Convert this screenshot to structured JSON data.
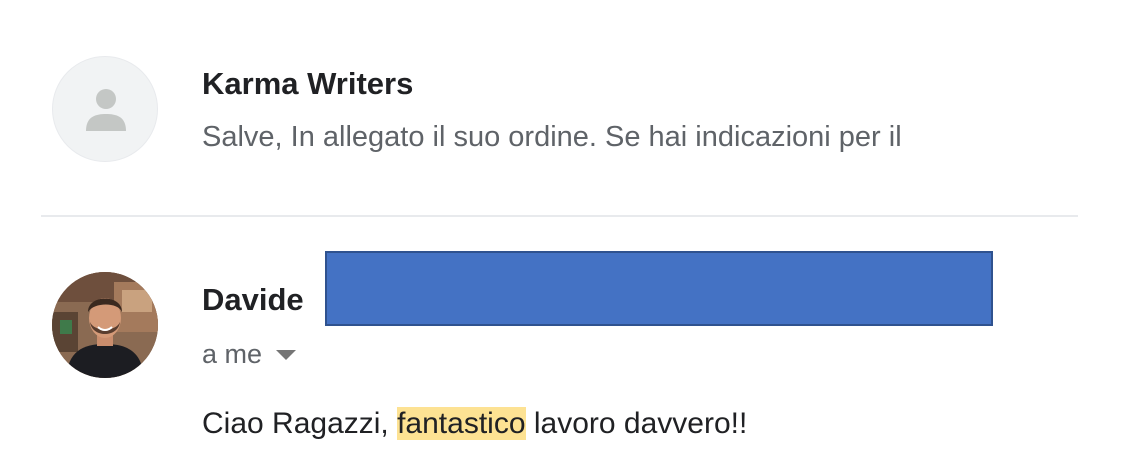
{
  "messages": [
    {
      "sender": "Karma Writers",
      "snippet": "Salve, In allegato il suo ordine. Se hai indicazioni per il",
      "avatar": "person-placeholder-icon"
    },
    {
      "sender": "Davide",
      "recipient": "a me",
      "body": {
        "before": "Ciao Ragazzi, ",
        "highlighted": "fantastico",
        "after": " lavoro davvero!!"
      },
      "avatar": "profile-photo"
    }
  ],
  "colors": {
    "redaction": "#4472c4",
    "highlight": "#fde293",
    "secondary_text": "#5f6368",
    "divider": "#e8eaed"
  },
  "icons": {
    "caret": "chevron-down-icon"
  }
}
